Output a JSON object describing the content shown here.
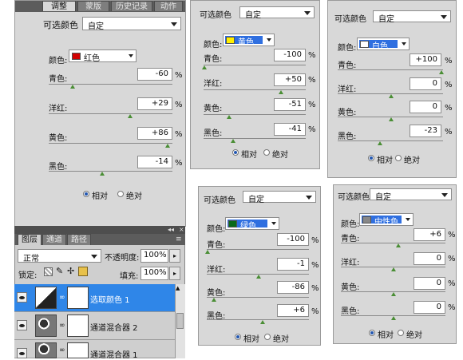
{
  "main_panel": {
    "tabs": [
      "调整",
      "蒙版",
      "历史记录",
      "动作"
    ],
    "title": "可选颜色",
    "preset": "自定",
    "color_label": "颜色:",
    "color_value": "红色",
    "color_swatch": "#d10000",
    "sliders": [
      {
        "label": "青色:",
        "value": "-60",
        "pct": "%"
      },
      {
        "label": "洋红:",
        "value": "+29",
        "pct": "%"
      },
      {
        "label": "黄色:",
        "value": "+86",
        "pct": "%"
      },
      {
        "label": "黑色:",
        "value": "-14",
        "pct": "%"
      }
    ],
    "radio_relative": "相对",
    "radio_absolute": "绝对"
  },
  "panel_yellow": {
    "title": "可选颜色",
    "preset": "自定",
    "color_label": "颜色:",
    "color_value": "黄色",
    "color_swatch": "#ffef00",
    "sliders": [
      {
        "label": "青色:",
        "value": "-100",
        "pct": "%"
      },
      {
        "label": "洋红:",
        "value": "+50",
        "pct": "%"
      },
      {
        "label": "黄色:",
        "value": "-51",
        "pct": "%"
      },
      {
        "label": "黑色:",
        "value": "-41",
        "pct": "%"
      }
    ],
    "radio_relative": "相对",
    "radio_absolute": "绝对"
  },
  "panel_white": {
    "title": "可选颜色",
    "preset": "自定",
    "color_label": "颜色:",
    "color_value": "白色",
    "color_swatch": "#ffffff",
    "sliders": [
      {
        "label": "青色:",
        "value": "+100",
        "pct": "%"
      },
      {
        "label": "洋红:",
        "value": "0",
        "pct": "%"
      },
      {
        "label": "黄色:",
        "value": "0",
        "pct": "%"
      },
      {
        "label": "黑色:",
        "value": "-23",
        "pct": "%"
      }
    ],
    "radio_relative": "相对",
    "radio_absolute": "绝对"
  },
  "panel_green": {
    "title": "可选颜色",
    "preset": "自定",
    "color_label": "颜色:",
    "color_value": "绿色",
    "color_swatch": "#0a6a1a",
    "sliders": [
      {
        "label": "青色:",
        "value": "-100",
        "pct": "%"
      },
      {
        "label": "洋红:",
        "value": "-1",
        "pct": "%"
      },
      {
        "label": "黄色:",
        "value": "-86",
        "pct": "%"
      },
      {
        "label": "黑色:",
        "value": "+6",
        "pct": "%"
      }
    ],
    "radio_relative": "相对",
    "radio_absolute": "绝对"
  },
  "panel_neutral": {
    "title": "可选颜色",
    "preset": "自定",
    "color_label": "颜色:",
    "color_value": "中性色",
    "color_swatch": "#888888",
    "sliders": [
      {
        "label": "青色:",
        "value": "+6",
        "pct": "%"
      },
      {
        "label": "洋红:",
        "value": "0",
        "pct": "%"
      },
      {
        "label": "黄色:",
        "value": "0",
        "pct": "%"
      },
      {
        "label": "黑色:",
        "value": "0",
        "pct": "%"
      }
    ],
    "radio_relative": "相对",
    "radio_absolute": "绝对"
  },
  "layers_panel": {
    "tabs": [
      "图层",
      "通道",
      "路径"
    ],
    "blend_mode": "正常",
    "opacity_label": "不透明度:",
    "opacity_value": "100%",
    "lock_label": "锁定:",
    "fill_label": "填充:",
    "fill_value": "100%",
    "layers": [
      {
        "name": "选取颜色 1"
      },
      {
        "name": "通道混合器 2"
      },
      {
        "name": "通道混合器 1"
      }
    ]
  },
  "icons": [
    "eye-icon",
    "chain-link-icon",
    "lock-icon",
    "brush-icon",
    "move-icon",
    "panel-menu-icon",
    "collapse-icon"
  ]
}
